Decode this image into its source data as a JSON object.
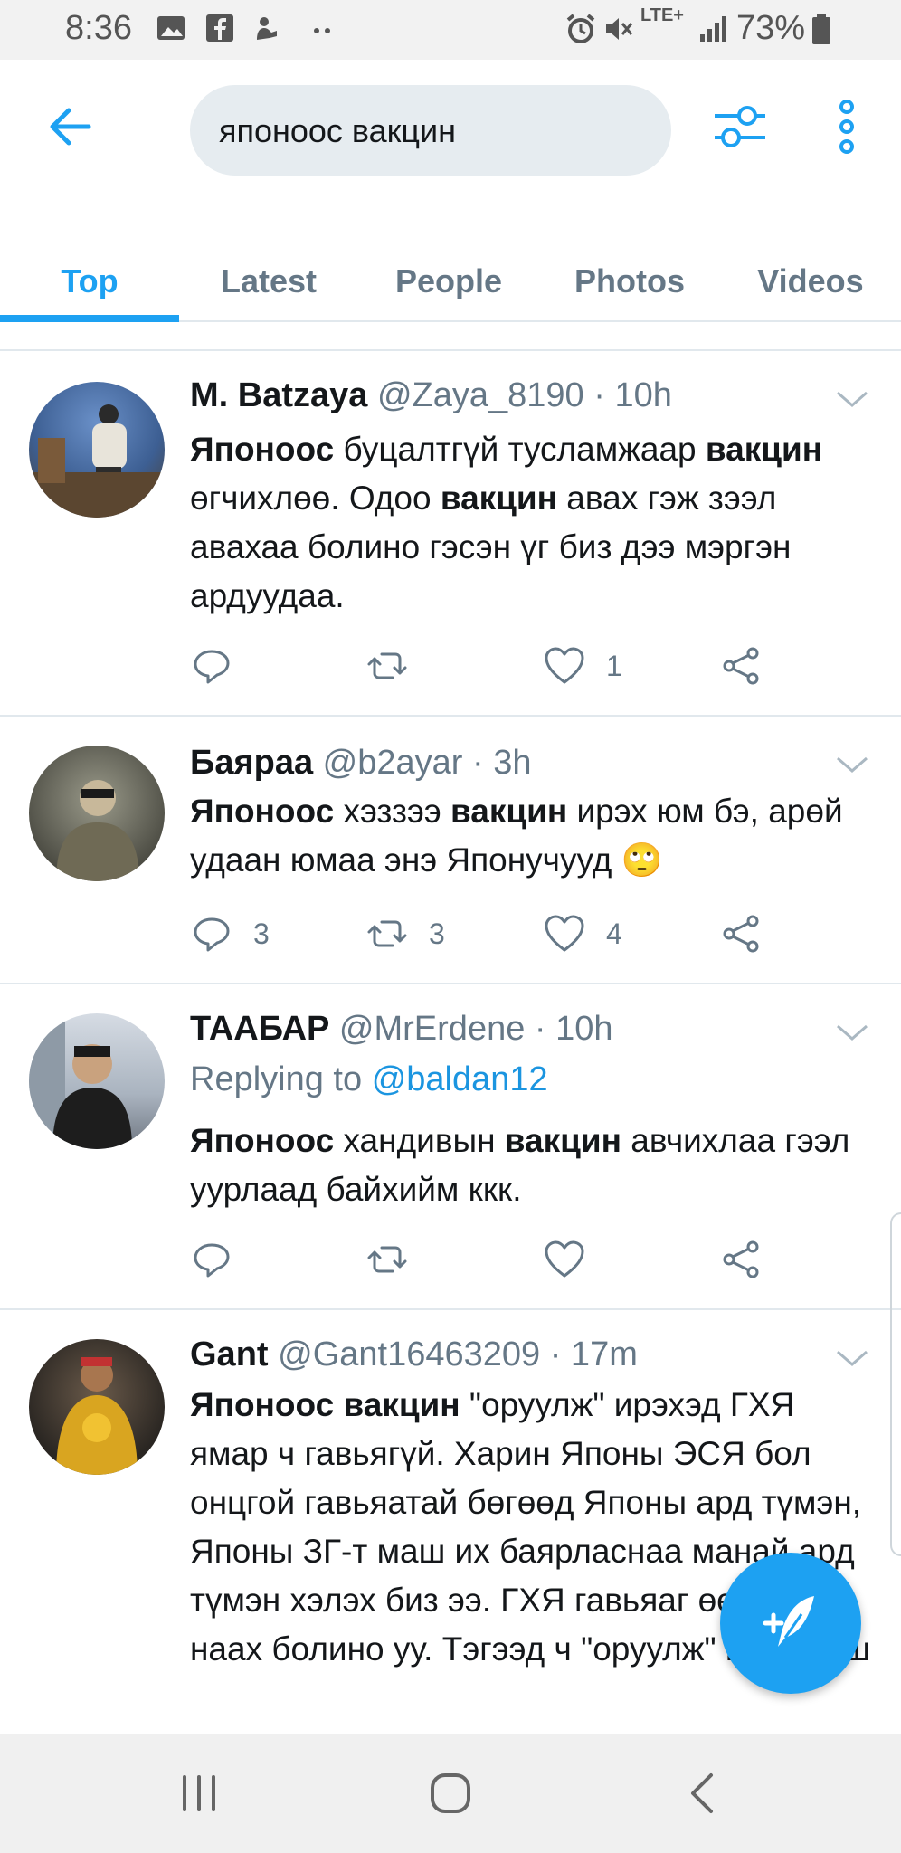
{
  "status_bar": {
    "time": "8:36",
    "network": "LTE+",
    "battery": "73%",
    "notification_icons": [
      "image-icon",
      "facebook-icon",
      "app-notification-icon",
      "more-dots-icon"
    ],
    "system_icons": [
      "alarm-icon",
      "mute-icon",
      "lte-icon",
      "signal-icon",
      "battery-icon"
    ]
  },
  "header": {
    "search_query": "японоос вакцин"
  },
  "tabs": [
    {
      "label": "Top",
      "active": true
    },
    {
      "label": "Latest",
      "active": false
    },
    {
      "label": "People",
      "active": false
    },
    {
      "label": "Photos",
      "active": false
    },
    {
      "label": "Videos",
      "active": false
    }
  ],
  "tweets": [
    {
      "name": "M. Batzaya",
      "handle": "@Zaya_8190",
      "time": "· 10h",
      "text_html": "<b>Японоос</b> буцалтгүй тусламжаар <b>вакцин</b> өгчихлөө. Одоо <b>вакцин</b> авах гэж зээл авахаа болино гэсэн үг биз дээ мэргэн ардуудаа.",
      "replies": "",
      "retweets": "",
      "likes": "1"
    },
    {
      "name": "Баяраа",
      "handle": "@b2ayar",
      "time": "· 3h",
      "text_html": "<b>Японоос</b> хэззээ <b>вакцин</b> ирэх юм бэ, арөй удаан юмаа энэ Японучууд 🙄",
      "replies": "3",
      "retweets": "3",
      "likes": "4"
    },
    {
      "name": "ТААБАР",
      "handle": "@MrErdene",
      "time": "· 10h",
      "reply_prefix": "Replying to",
      "reply_to": "@baldan12",
      "text_html": "<b>Японоос</b> хандивын <b>вакцин</b> авчихлаа гээл уурлаад байхийм ккк.",
      "replies": "",
      "retweets": "",
      "likes": ""
    },
    {
      "name": "Gant",
      "handle": "@Gant16463209",
      "time": "· 17m",
      "text_html": "<b>Японоос вакцин</b> \"оруулж\" ирэхэд ГХЯ ямар ч гавьягүй. Харин Японы ЭСЯ бол онцгой гавьяатай бөгөөд Японы ард түмэн, Японы ЗГ-т маш их баярласнаа манай ард түмэн хэлэх биз ээ. ГХЯ гавьяаг өөртөө наах болино уу. Тэгээд ч \"оруулж\" ирэх биш"
    }
  ],
  "colors": {
    "accent": "#1da1f2",
    "text": "#14171a",
    "secondary": "#657786",
    "divider": "#e1e8ed"
  }
}
